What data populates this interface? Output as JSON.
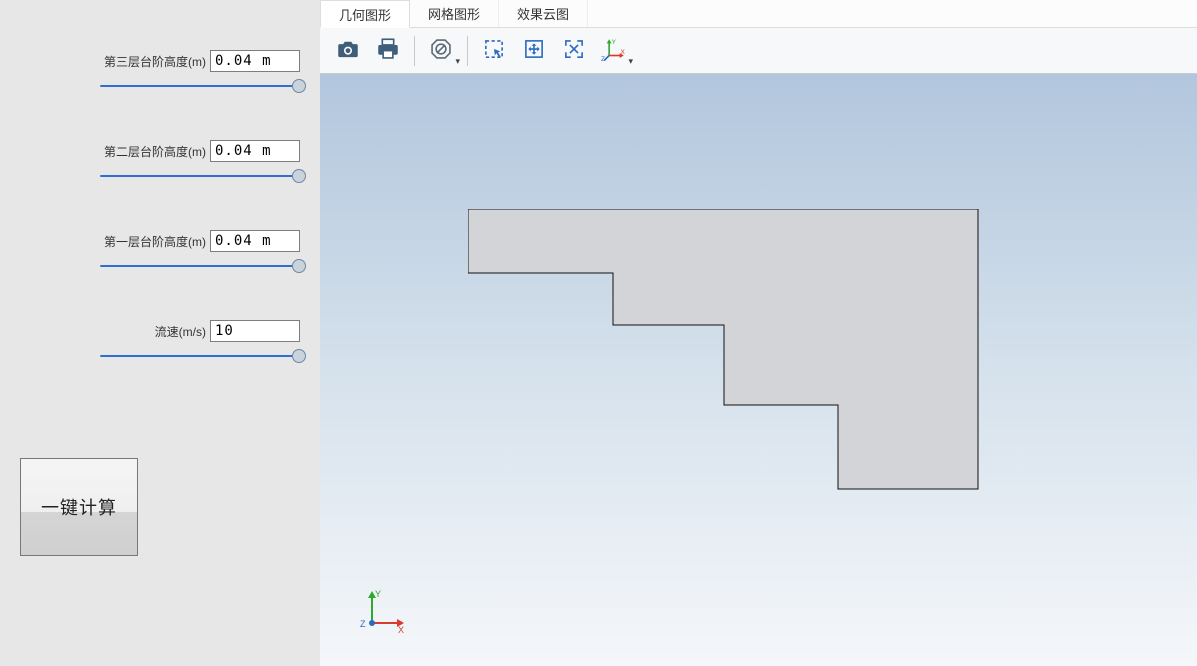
{
  "sidebar": {
    "params": [
      {
        "label": "第三层台阶高度(m)",
        "value": "0.04 m"
      },
      {
        "label": "第二层台阶高度(m)",
        "value": "0.04 m"
      },
      {
        "label": "第一层台阶高度(m)",
        "value": "0.04 m"
      },
      {
        "label": "流速(m/s)",
        "value": "10"
      }
    ],
    "calc_button": "一键计算"
  },
  "tabs": [
    {
      "label": "几何图形",
      "active": true
    },
    {
      "label": "网格图形",
      "active": false
    },
    {
      "label": "效果云图",
      "active": false
    }
  ],
  "toolbar": {
    "camera": "camera-icon",
    "print": "print-icon",
    "deny": "deny-icon",
    "select_rect": "select-rect-icon",
    "pan": "pan-icon",
    "fit": "fit-icon",
    "axis": "axis-icon"
  },
  "viewport": {
    "axis_labels": {
      "x": "X",
      "y": "Y",
      "z": "Z"
    }
  }
}
